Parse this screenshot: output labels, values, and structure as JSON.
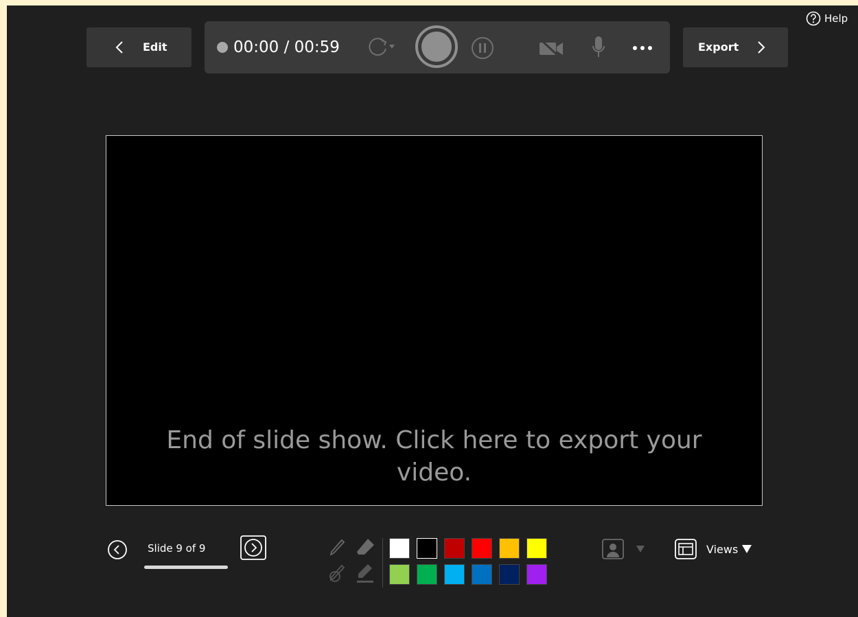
{
  "header": {
    "edit_label": "Edit",
    "export_label": "Export",
    "help_label": "Help"
  },
  "recording": {
    "time_display": "00:00 / 00:59"
  },
  "slide": {
    "message": "End of slide show. Click here to export your video."
  },
  "navigation": {
    "slide_counter": "Slide 9 of 9"
  },
  "ink_colors": [
    "#ffffff",
    "#000000",
    "#c00000",
    "#ff0000",
    "#ffc000",
    "#ffff00",
    "#92d050",
    "#00b050",
    "#00b0f0",
    "#0070c0",
    "#002060",
    "#a020f0"
  ],
  "views": {
    "label": "Views"
  },
  "icons": {
    "back": "chevron-left-icon",
    "forward": "chevron-right-icon",
    "help": "question-circle-icon",
    "record": "record-icon",
    "pause": "pause-icon",
    "camera": "camera-off-icon",
    "mic": "microphone-icon",
    "more": "more-icon",
    "pen": "pen-icon",
    "eraser": "eraser-icon",
    "clear": "clear-ink-icon",
    "highlighter": "highlighter-icon",
    "presenter": "presenter-camera-icon",
    "views": "layout-icon"
  }
}
